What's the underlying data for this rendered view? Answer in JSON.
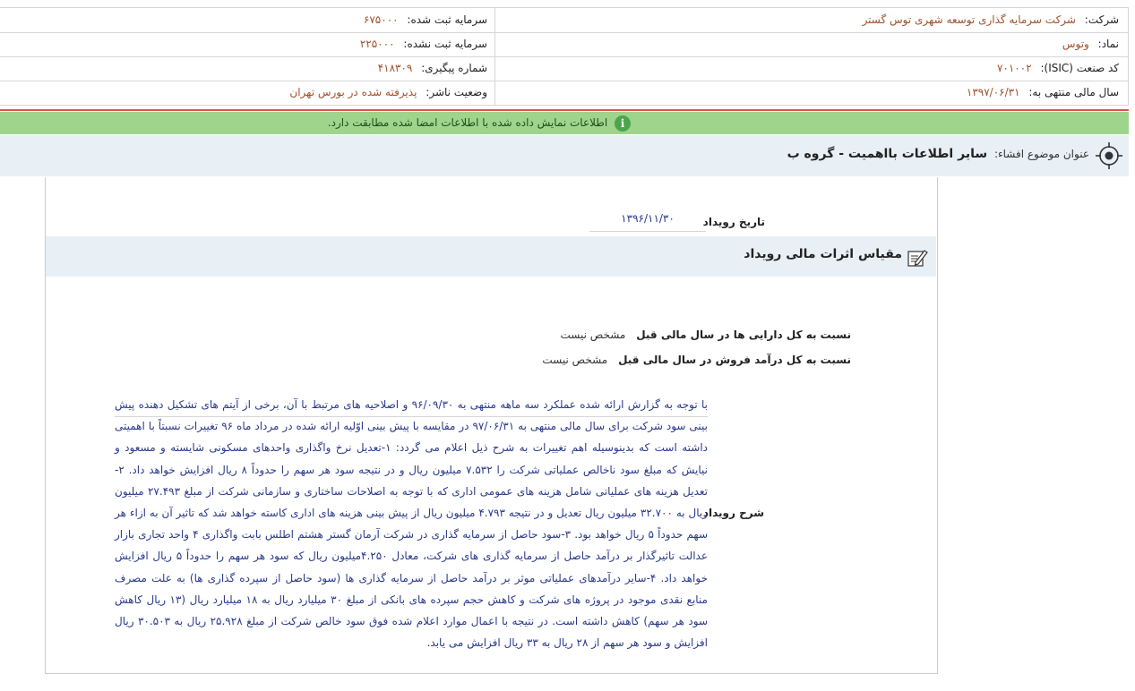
{
  "info": {
    "company_label": "شرکت:",
    "company_value": "شرکت سرمایه گذاری توسعه شهری توس گستر",
    "registered_capital_label": "سرمایه ثبت شده:",
    "registered_capital_value": "۶۷۵۰۰۰",
    "symbol_label": "نماد:",
    "symbol_value": "وتوس",
    "unregistered_capital_label": "سرمایه ثبت نشده:",
    "unregistered_capital_value": "۲۲۵۰۰۰",
    "isic_label": "کد صنعت (ISIC):",
    "isic_value": "۷۰۱۰۰۲",
    "tracking_label": "شماره پیگیری:",
    "tracking_value": "۴۱۸۳۰۹",
    "fiscal_year_label": "سال مالی منتهی به:",
    "fiscal_year_value": "۱۳۹۷/۰۶/۳۱",
    "publisher_status_label": "وضعیت ناشر:",
    "publisher_status_value": "پذیرفته شده در بورس تهران"
  },
  "notice": {
    "icon": "info-icon",
    "text": "اطلاعات نمایش داده شده با اطلاعات امضا شده مطابقت دارد."
  },
  "subject": {
    "label": "عنوان موضوع افشاء:",
    "title": "سایر اطلاعات بااهمیت - گروه ب"
  },
  "event": {
    "date_label": "تاریخ رویداد",
    "date_value": "۱۳۹۶/۱۱/۳۰",
    "section_title": "مقیاس اثرات مالی رویداد",
    "assets_ratio_label": "نسبت به کل دارایی ها در سال مالی قبل",
    "assets_ratio_value": "مشخص نیست",
    "revenue_ratio_label": "نسبت به کل درآمد فروش در سال مالی قبل",
    "revenue_ratio_value": "مشخص نیست",
    "description_label": "شرح رویداد",
    "description_text": "با توجه به گزارش ارائه شده عملکرد سه ماهه منتهی به ۹۶/۰۹/۳۰ و اصلاحیه های مرتبط با آن، برخی از آیتم های تشکیل دهنده پیش بینی سود شرکت برای سال مالی منتهی به ۹۷/۰۶/۳۱ در مقایسه با پیش بینی اوّلیه ارائه شده در مرداد ماه ۹۶ تغییرات نسبتاً با اهمیتی داشته است که بدینوسیله اهم تغییرات به شرح ذیل اعلام می گردد: ۱-تعدیل نرخ واگذاری واحدهای مسکونی شایسته و مسعود و نیایش که مبلغ سود ناخالص عملیاتی شرکت را ۷.۵۳۲ میلیون ریال و در نتیجه سود هر سهم را حدوداً ۸ ریال افزایش خواهد داد. ۲-تعدیل هزینه های عملیاتی شامل هزینه های عمومی اداری که با توجه به اصلاحات ساختاری و سازمانی شرکت از مبلغ ۲۷.۴۹۳ میلیون ریال به ۳۲.۷۰۰ میلیون ریال تعدیل و در نتیجه ۴.۷۹۳ میلیون ریال از پیش بینی هزینه های اداری کاسته خواهد شد که تاثیر آن به ازاء هر سهم حدوداً ۵ ریال خواهد بود. ۳-سود حاصل از سرمایه گذاری در شرکت آرمان گستر هشتم اطلس بابت واگذاری ۴ واحد تجاری بازار عدالت تاثیرگذار بر درآمد حاصل از سرمایه گذاری های شرکت، معادل ۴.۲۵۰میلیون ریال که سود هر سهم را حدوداً ۵ ریال افزایش خواهد داد. ۴-سایر درآمدهای عملیاتی موثر بر درآمد حاصل از سرمایه گذاری ها (سود حاصل از سپرده گذاری ها) به علت مصرف منابع نقدی موجود در پروژه های شرکت و کاهش حجم سپرده های بانکی از مبلغ ۳۰ میلیارد ریال به ۱۸ میلیارد ریال (۱۳ ریال کاهش سود هر سهم) کاهش داشته است. در نتیجه با اعمال موارد اعلام شده فوق سود خالص شرکت از مبلغ ۲۵.۹۲۸ ریال به ۳۰.۵۰۳ ریال افزایش و سود هر سهم از ۲۸ ریال به ۳۳ ریال افزایش می یابد."
  },
  "colors": {
    "value_brown": "#a0522d",
    "value_blue": "#2a3a8a",
    "notice_green": "#9ed48c",
    "alert_red": "#e05050",
    "subject_bg": "#e8f0f6"
  }
}
